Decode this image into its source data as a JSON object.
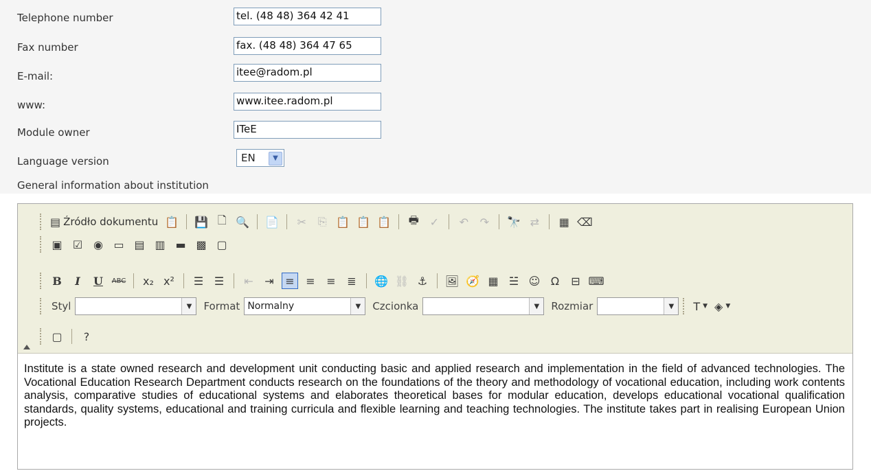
{
  "form": {
    "fields": [
      {
        "label": "Telephone number",
        "value": "tel. (48 48) 364 42 41"
      },
      {
        "label": "Fax number",
        "value": "fax. (48 48) 364 47 65"
      },
      {
        "label": "E-mail:",
        "value": "itee@radom.pl"
      },
      {
        "label": "www:",
        "value": "www.itee.radom.pl"
      },
      {
        "label": "Module owner",
        "value": "ITeE"
      }
    ],
    "language_label": "Language version",
    "language_value": "EN",
    "general_info_label": "General information about institution"
  },
  "toolbar": {
    "source_label": "Źródło dokumentu",
    "style_label": "Styl",
    "style_value": "",
    "format_label": "Format",
    "format_value": "Normalny",
    "font_label": "Czcionka",
    "font_value": "",
    "size_label": "Rozmiar",
    "size_value": "",
    "bold_label": "B",
    "italic_label": "I",
    "underline_label": "U",
    "strike_label": "ABC"
  },
  "editor": {
    "content": "Institute is a state owned research and development unit conducting basic and applied research and implementation in the field of advanced technologies. The Vocational Education Research Department conducts research on the foundations of the theory and methodology of vocational education, including work contents analysis, comparative studies of educational systems and elaborates theoretical bases for modular education, develops educational vocational qualification standards, quality systems, educational and training curricula and flexible learning and teaching technologies. The institute takes part in realising European Union projects."
  },
  "icons": {
    "row1": [
      "source-icon",
      "paste-text-icon",
      "save-icon",
      "new-page-icon",
      "preview-icon",
      "templates-icon",
      "cut-icon",
      "copy-icon",
      "paste-icon",
      "paste-plain-icon",
      "paste-word-icon",
      "print-icon",
      "spellcheck-icon",
      "undo-icon",
      "redo-icon",
      "find-icon",
      "replace-icon",
      "select-all-icon",
      "remove-format-icon"
    ],
    "row2": [
      "form-icon",
      "checkbox-icon",
      "radio-icon",
      "textfield-icon",
      "textarea-icon",
      "select-icon",
      "button-icon",
      "image-button-icon",
      "hidden-field-icon"
    ],
    "row3": [
      "bold-icon",
      "italic-icon",
      "underline-icon",
      "strike-icon",
      "subscript-icon",
      "superscript-icon",
      "ordered-list-icon",
      "unordered-list-icon",
      "outdent-icon",
      "indent-icon",
      "align-left-icon",
      "align-center-icon",
      "align-right-icon",
      "justify-icon",
      "link-icon",
      "unlink-icon",
      "anchor-icon",
      "image-icon",
      "flash-icon",
      "table-icon",
      "horizontal-rule-icon",
      "smiley-icon",
      "special-char-icon",
      "page-break-icon",
      "universal-key-icon"
    ],
    "row5": [
      "show-blocks-icon",
      "about-icon"
    ]
  }
}
